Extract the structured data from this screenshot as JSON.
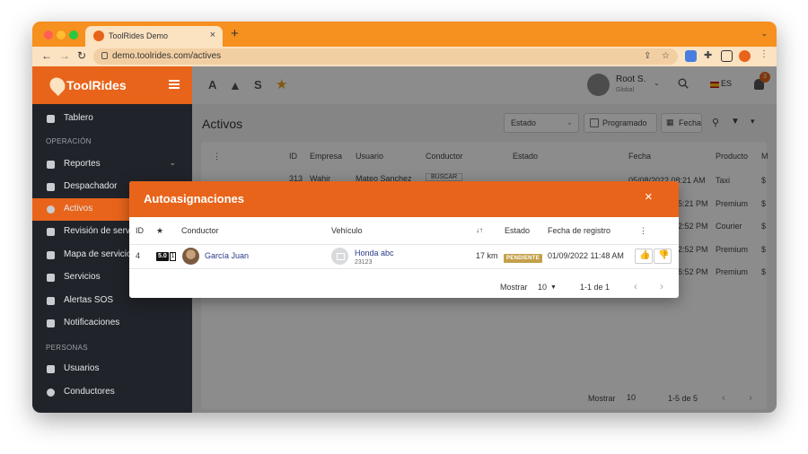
{
  "browser": {
    "tab_title": "ToolRides Demo",
    "tab_close": "×",
    "new_tab": "+",
    "url": "demo.toolrides.com/actives",
    "ext_badge": "3"
  },
  "app": {
    "brand": "ToolRides",
    "header": {
      "quick_a": "A",
      "quick_s": "S",
      "user_name": "Root S.",
      "user_role": "Global",
      "lang": "ES",
      "notifications": "3"
    },
    "sidebar": {
      "items": [
        {
          "label": "Tablero"
        },
        {
          "section": "OPERACIÓN"
        },
        {
          "label": "Reportes"
        },
        {
          "label": "Despachador"
        },
        {
          "label": "Activos"
        },
        {
          "label": "Revisión de servic"
        },
        {
          "label": "Mapa de servicios"
        },
        {
          "label": "Servicios"
        },
        {
          "label": "Alertas SOS"
        },
        {
          "label": "Notificaciones"
        },
        {
          "section": "PERSONAS"
        },
        {
          "label": "Usuarios"
        },
        {
          "label": "Conductores"
        }
      ]
    },
    "page": {
      "title": "Activos",
      "filter_estado": "Estado",
      "filter_programado": "Programado",
      "filter_fecha": "Fecha",
      "columns": [
        "ID",
        "Empresa",
        "Usuario",
        "Conductor",
        "Estado",
        "Fecha",
        "Producto",
        "M"
      ],
      "row_partial": {
        "id": "313",
        "empresa": "Wahir",
        "usuario": "Mateo Sanchez",
        "conductor": "BUSCAR"
      },
      "dates": [
        "05/08/2022 08:21 AM",
        "5:21 PM",
        "2:52 PM",
        "2:52 PM",
        "6:52 PM"
      ],
      "products": [
        "Taxi",
        "Premium",
        "Courier",
        "Premium",
        "Premium"
      ],
      "money": [
        "$",
        "$",
        "$",
        "$",
        "$"
      ],
      "footer_show": "Mostrar",
      "footer_size": "10",
      "footer_range": "1-5 de 5"
    }
  },
  "modal": {
    "title": "Autoasignaciones",
    "close": "×",
    "columns": {
      "id": "ID",
      "rating": "★",
      "driver": "Conductor",
      "vehicle": "Vehículo",
      "distance": "↓↑",
      "status": "Estado",
      "registered": "Fecha de registro",
      "menu": "⋮"
    },
    "rows": [
      {
        "id": "4",
        "rating": "5.0",
        "rating_count": "1",
        "driver": "García Juan",
        "vehicle": "Honda abc",
        "plate": "23123",
        "distance": "17 km",
        "status": "PENDIENTE",
        "registered": "01/09/2022 11:48 AM",
        "accept": "👍",
        "reject": "👎"
      }
    ],
    "footer": {
      "show": "Mostrar",
      "page_size": "10",
      "range": "1-1 de 1",
      "prev": "‹",
      "next": "›"
    }
  }
}
